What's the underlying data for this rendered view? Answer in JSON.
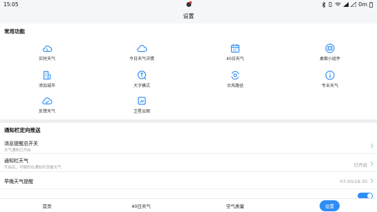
{
  "statusbar": {
    "time": "15:05",
    "speed": "0m"
  },
  "title": "设置",
  "common": {
    "title": "常用功能",
    "tiles": [
      {
        "label": "实时天气",
        "icon": "cloud-icon"
      },
      {
        "label": "今日天气详情",
        "icon": "cloud-sun-icon"
      },
      {
        "label": "40日天气",
        "icon": "calendar-icon"
      },
      {
        "label": "桌面小组件",
        "icon": "widget-icon"
      },
      {
        "label": "添加城市",
        "icon": "building-icon"
      },
      {
        "label": "大字模式",
        "icon": "large-text-icon"
      },
      {
        "label": "台风路径",
        "icon": "typhoon-icon"
      },
      {
        "label": "专业天气",
        "icon": "info-icon"
      },
      {
        "label": "反馈天气",
        "icon": "feedback-cloud-icon"
      },
      {
        "label": "卫星云图",
        "icon": "satellite-icon"
      }
    ]
  },
  "notification": {
    "title": "通知栏定向推送",
    "rows": [
      {
        "title": "消息提醒总开关",
        "sub": "天气通知已开启"
      },
      {
        "title": "通知栏天气",
        "sub": "开启后，可随时在通知栏查看天气",
        "value": "已开启"
      },
      {
        "title": "早晚天气提醒",
        "value": "07:00/18:30"
      }
    ]
  },
  "tabs": [
    {
      "label": "首页"
    },
    {
      "label": "40日天气"
    },
    {
      "label": "空气质量"
    },
    {
      "label": "设置"
    }
  ],
  "colors": {
    "accent": "#2f8ef6"
  }
}
